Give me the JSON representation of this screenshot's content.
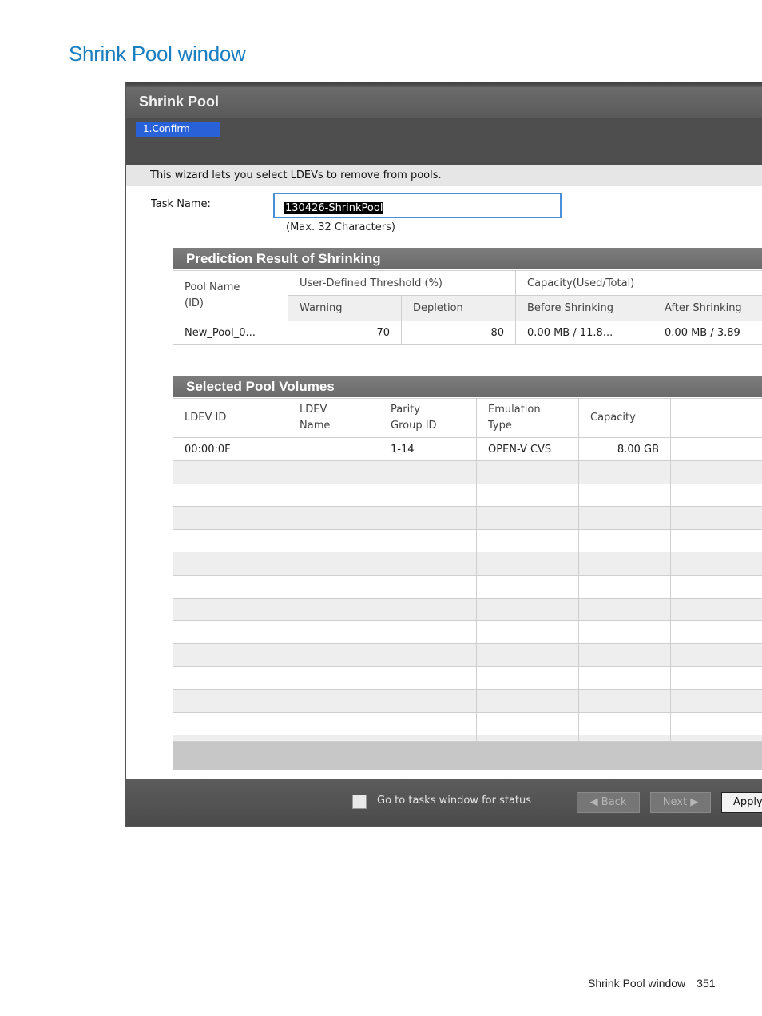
{
  "doc": {
    "title": "Shrink Pool window",
    "footer_label": "Shrink Pool window",
    "page_number": "351"
  },
  "window": {
    "title": "Shrink Pool",
    "step": "1.Confirm",
    "intro": "This wizard lets you select LDEVs to remove from pools.",
    "task_label": "Task Name:",
    "task_value": "130426-ShrinkPool",
    "task_hint": "(Max. 32 Characters)"
  },
  "prediction": {
    "heading": "Prediction Result of Shrinking",
    "col_pool": "Pool Name\n(ID)",
    "grp_threshold": "User-Defined Threshold (%)",
    "grp_capacity": "Capacity(Used/Total)",
    "col_warning": "Warning",
    "col_depletion": "Depletion",
    "col_before": "Before Shrinking",
    "col_after": "After Shrinking",
    "row": {
      "pool": "New_Pool_0...",
      "warning": "70",
      "depletion": "80",
      "before": "0.00 MB / 11.8...",
      "after": "0.00 MB / 3.89"
    }
  },
  "volumes": {
    "heading": "Selected Pool Volumes",
    "headers": [
      "LDEV ID",
      "LDEV\nName",
      "Parity\nGroup ID",
      "Emulation\nType",
      "Capacity",
      ""
    ],
    "rows": [
      [
        "00:00:0F",
        "",
        "1-14",
        "OPEN-V CVS",
        "8.00 GB",
        ""
      ]
    ]
  },
  "footer": {
    "checkbox_label": "Go to tasks window for status",
    "back": "Back",
    "next": "Next",
    "apply": "Apply"
  }
}
